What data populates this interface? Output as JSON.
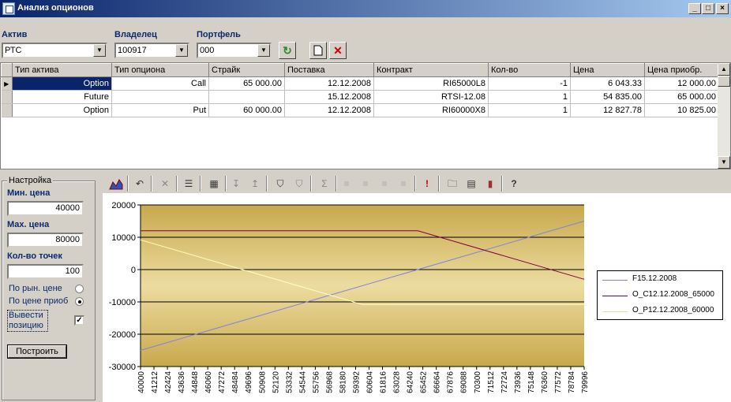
{
  "window": {
    "title": "Анализ опционов",
    "minimize": "_",
    "maximize": "□",
    "close": "×"
  },
  "selectors": {
    "asset_label": "Актив",
    "asset_value": "РТС",
    "owner_label": "Владелец",
    "owner_value": "100917",
    "portfolio_label": "Портфель",
    "portfolio_value": "000"
  },
  "grid": {
    "columns": [
      "Тип актива",
      "Тип опциона",
      "Страйк",
      "Поставка",
      "Контракт",
      "Кол-во",
      "Цена",
      "Цена приобр."
    ],
    "rows": [
      [
        "Option",
        "Call",
        "65 000.00",
        "12.12.2008",
        "RI65000L8",
        "-1",
        "6 043.33",
        "12 000.00"
      ],
      [
        "Future",
        "",
        "",
        "15.12.2008",
        "RTSI-12.08",
        "1",
        "54 835.00",
        "65 000.00"
      ],
      [
        "Option",
        "Put",
        "60 000.00",
        "12.12.2008",
        "RI60000X8",
        "1",
        "12 827.78",
        "10 825.00"
      ]
    ]
  },
  "settings": {
    "group_title": "Настройка",
    "min_price_label": "Мин. цена",
    "min_price": "40000",
    "max_price_label": "Мах. цена",
    "max_price": "80000",
    "points_label": "Кол-во точек",
    "points": "100",
    "by_market_label": "По рын. цене",
    "by_market_checked": false,
    "by_purchase_label": "По цене приоб",
    "by_purchase_checked": true,
    "show_position_label_1": "Вывести",
    "show_position_label_2": "позицию",
    "show_position_checked": true,
    "build_button": "Построить"
  },
  "chart_data": {
    "type": "line",
    "ylim": [
      -30000,
      20000
    ],
    "yticks": [
      "20000",
      "10000",
      "0",
      "-10000",
      "-20000",
      "-30000"
    ],
    "xlim": [
      40000,
      79996
    ],
    "x_tick_labels": [
      "40000",
      "41212",
      "42424",
      "43636",
      "44848",
      "46060",
      "47272",
      "48484",
      "49696",
      "50908",
      "52120",
      "53332",
      "54544",
      "55756",
      "56968",
      "58180",
      "59392",
      "60604",
      "61816",
      "63028",
      "64240",
      "65452",
      "66664",
      "67876",
      "69088",
      "70300",
      "71512",
      "72724",
      "73936",
      "75148",
      "76360",
      "77572",
      "78784",
      "79996"
    ],
    "series": [
      {
        "name": "F15.12.2008",
        "color": "#8080e0",
        "x": [
          40000,
          79996
        ],
        "y": [
          -25000,
          15000
        ]
      },
      {
        "name": "O_C12.12.2008_65000",
        "color": "#800040",
        "x": [
          40000,
          65000,
          79996
        ],
        "y": [
          12000,
          12000,
          -3000
        ]
      },
      {
        "name": "O_P12.12.2008_60000",
        "color": "#ffffc0",
        "x": [
          40000,
          60000,
          79996
        ],
        "y": [
          9200,
          -10800,
          -10800
        ]
      }
    ],
    "legend_position": "right"
  },
  "colors": {
    "titlebar_start": "#0a246a",
    "titlebar_end": "#a6caf0",
    "selection": "#0a246a",
    "plot_gold_dark": "#c8a84c",
    "plot_gold_light": "#ecdca0"
  }
}
